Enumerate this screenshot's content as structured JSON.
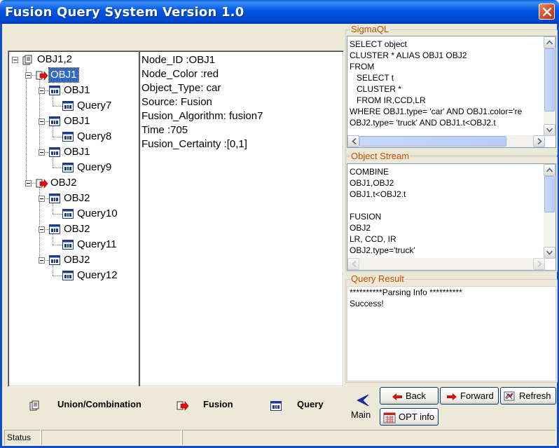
{
  "window": {
    "title": "Fusion Query System Version 1.0"
  },
  "tree": [
    {
      "label": "OBJ1,2",
      "icon": "union-icon",
      "depth": 0
    },
    {
      "label": "OBJ1",
      "icon": "fusion-icon",
      "depth": 1,
      "selected": true
    },
    {
      "label": "OBJ1",
      "icon": "query-icon",
      "depth": 2
    },
    {
      "label": "Query7",
      "icon": "query-icon",
      "depth": 3
    },
    {
      "label": "OBJ1",
      "icon": "query-icon",
      "depth": 2
    },
    {
      "label": "Query8",
      "icon": "query-icon",
      "depth": 3
    },
    {
      "label": "OBJ1",
      "icon": "query-icon",
      "depth": 2
    },
    {
      "label": "Query9",
      "icon": "query-icon",
      "depth": 3
    },
    {
      "label": "OBJ2",
      "icon": "fusion-icon",
      "depth": 1
    },
    {
      "label": "OBJ2",
      "icon": "query-icon",
      "depth": 2
    },
    {
      "label": "Query10",
      "icon": "query-icon",
      "depth": 3
    },
    {
      "label": "OBJ2",
      "icon": "query-icon",
      "depth": 2
    },
    {
      "label": "Query11",
      "icon": "query-icon",
      "depth": 3
    },
    {
      "label": "OBJ2",
      "icon": "query-icon",
      "depth": 2
    },
    {
      "label": "Query12",
      "icon": "query-icon",
      "depth": 3
    }
  ],
  "details": {
    "lines": [
      "Node_ID :OBJ1",
      "Node_Color :red",
      "Object_Type: car",
      "Source: Fusion",
      "Fusion_Algorithm: fusion7",
      "Time :705",
      "Fusion_Certainty :[0,1]"
    ]
  },
  "sigmaql": {
    "caption": "SigmaQL",
    "text": "SELECT object\nCLUSTER * ALIAS OBJ1 OBJ2\nFROM\n   SELECT t\n   CLUSTER *\n   FROM IR,CCD,LR\nWHERE OBJ1.type= 'car' AND OBJ1.color='re\nOBJ2.type= 'truck' AND OBJ1.t<OBJ2.t"
  },
  "object_stream": {
    "caption": "Object Stream",
    "text": "COMBINE\nOBJ1,OBJ2\nOBJ1.t<OBJ2.t\n\nFUSION\nOBJ2\nLR, CCD, IR\nOBJ2.type='truck'"
  },
  "query_result": {
    "caption": "Query Result",
    "text": "**********Parsing Info **********\nSuccess!"
  },
  "legend": {
    "union": "Union/Combination",
    "fusion": "Fusion",
    "query": "Query"
  },
  "nav": {
    "main": "Main",
    "back": "Back",
    "forward": "Forward",
    "refresh": "Refresh",
    "opt_info": "OPT info"
  },
  "status": {
    "label": "Status"
  }
}
